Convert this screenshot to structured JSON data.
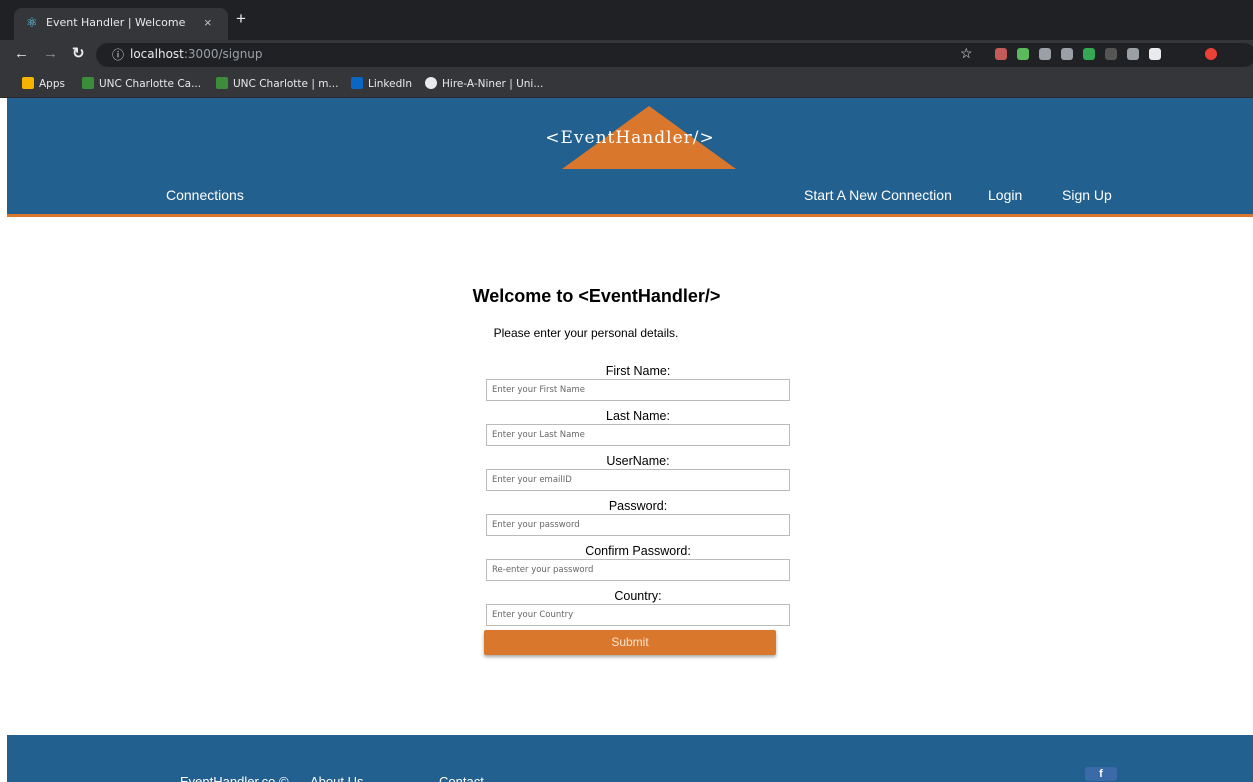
{
  "browser": {
    "tab_title": "Event Handler | Welcome",
    "tab_close": "×",
    "new_tab": "+",
    "url_host": "localhost",
    "url_rest": ":3000/signup",
    "bookmarks": [
      {
        "label": "Apps",
        "icon": "apps-grid-icon",
        "color": "#f4b400"
      },
      {
        "label": "UNC Charlotte Ca...",
        "icon": "unc-icon",
        "color": "#3c8c3c"
      },
      {
        "label": "UNC Charlotte | m...",
        "icon": "unc-icon",
        "color": "#3c8c3c"
      },
      {
        "label": "LinkedIn",
        "icon": "linkedin-icon",
        "color": "#0a66c2"
      },
      {
        "label": "Hire-A-Niner | Uni...",
        "icon": "globe-icon",
        "color": "#e8eaed"
      }
    ],
    "extensions": [
      "#c55a5a",
      "#5cb85c",
      "#9aa0a6",
      "#9aa0a6",
      "#34a853",
      "#555555",
      "#9aa0a6",
      "#e8eaed",
      "#ea4335"
    ]
  },
  "header": {
    "logo": "<EventHandler/>",
    "nav": {
      "connections": "Connections",
      "new_connection": "Start A New Connection",
      "login": "Login",
      "signup": "Sign Up"
    }
  },
  "form": {
    "title": "Welcome to <EventHandler/>",
    "subtitle": "Please enter your personal details.",
    "fields": [
      {
        "label": "First Name:",
        "placeholder": "Enter your First Name"
      },
      {
        "label": "Last Name:",
        "placeholder": "Enter your Last Name"
      },
      {
        "label": "UserName:",
        "placeholder": "Enter your emailID"
      },
      {
        "label": "Password:",
        "placeholder": "Enter your password"
      },
      {
        "label": "Confirm Password:",
        "placeholder": "Re-enter your password"
      },
      {
        "label": "Country:",
        "placeholder": "Enter your Country"
      }
    ],
    "submit": "Submit"
  },
  "footer": {
    "copyright": "EventHandler.co ©",
    "about": "About Us",
    "contact": "Contact",
    "facebook": "f"
  },
  "colors": {
    "header_blue": "#22608f",
    "accent_orange": "#d9782c"
  }
}
